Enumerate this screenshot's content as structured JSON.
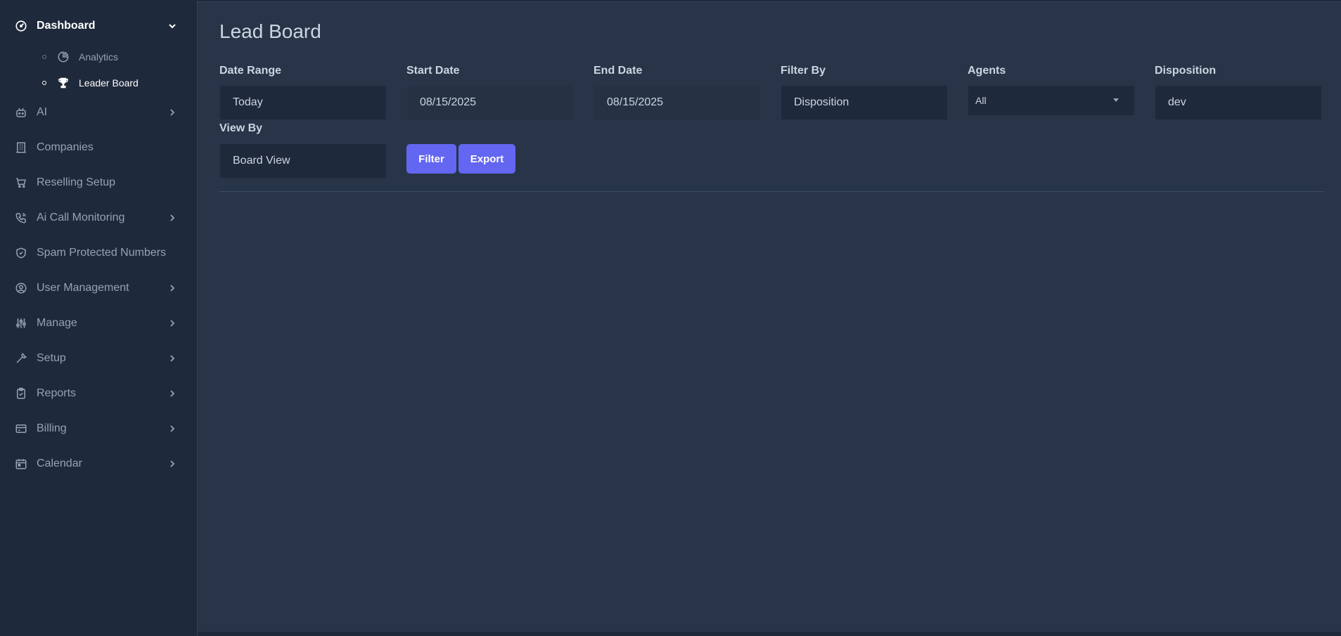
{
  "sidebar": {
    "dashboard": {
      "label": "Dashboard",
      "icon": "gauge-icon"
    },
    "sub_items": [
      {
        "label": "Analytics",
        "icon": "pie-chart-icon"
      },
      {
        "label": "Leader Board",
        "icon": "trophy-icon"
      }
    ],
    "items": [
      {
        "label": "AI",
        "icon": "robot-icon"
      },
      {
        "label": "Companies",
        "icon": "building-icon"
      },
      {
        "label": "Reselling Setup",
        "icon": "cart-icon"
      },
      {
        "label": "Ai Call Monitoring",
        "icon": "phone-call-icon"
      },
      {
        "label": "Spam Protected Numbers",
        "icon": "shield-check-icon"
      },
      {
        "label": "User Management",
        "icon": "user-circle-icon"
      },
      {
        "label": "Manage",
        "icon": "sliders-icon"
      },
      {
        "label": "Setup",
        "icon": "wrench-icon"
      },
      {
        "label": "Reports",
        "icon": "clipboard-icon"
      },
      {
        "label": "Billing",
        "icon": "credit-card-icon"
      },
      {
        "label": "Calendar",
        "icon": "calendar-icon"
      }
    ]
  },
  "main": {
    "title": "Lead Board",
    "filters": {
      "date_range": {
        "label": "Date Range",
        "value": "Today"
      },
      "start_date": {
        "label": "Start Date",
        "value": "08/15/2025"
      },
      "end_date": {
        "label": "End Date",
        "value": "08/15/2025"
      },
      "filter_by": {
        "label": "Filter By",
        "value": "Disposition"
      },
      "agents": {
        "label": "Agents",
        "value": "All"
      },
      "disposition": {
        "label": "Disposition",
        "value": "dev"
      },
      "view_by": {
        "label": "View By",
        "value": "Board View"
      }
    },
    "buttons": {
      "filter": "Filter",
      "export": "Export"
    }
  },
  "colors": {
    "accent": "#6366f1",
    "sidebar_bg": "#1e293b",
    "main_bg": "#283548"
  }
}
